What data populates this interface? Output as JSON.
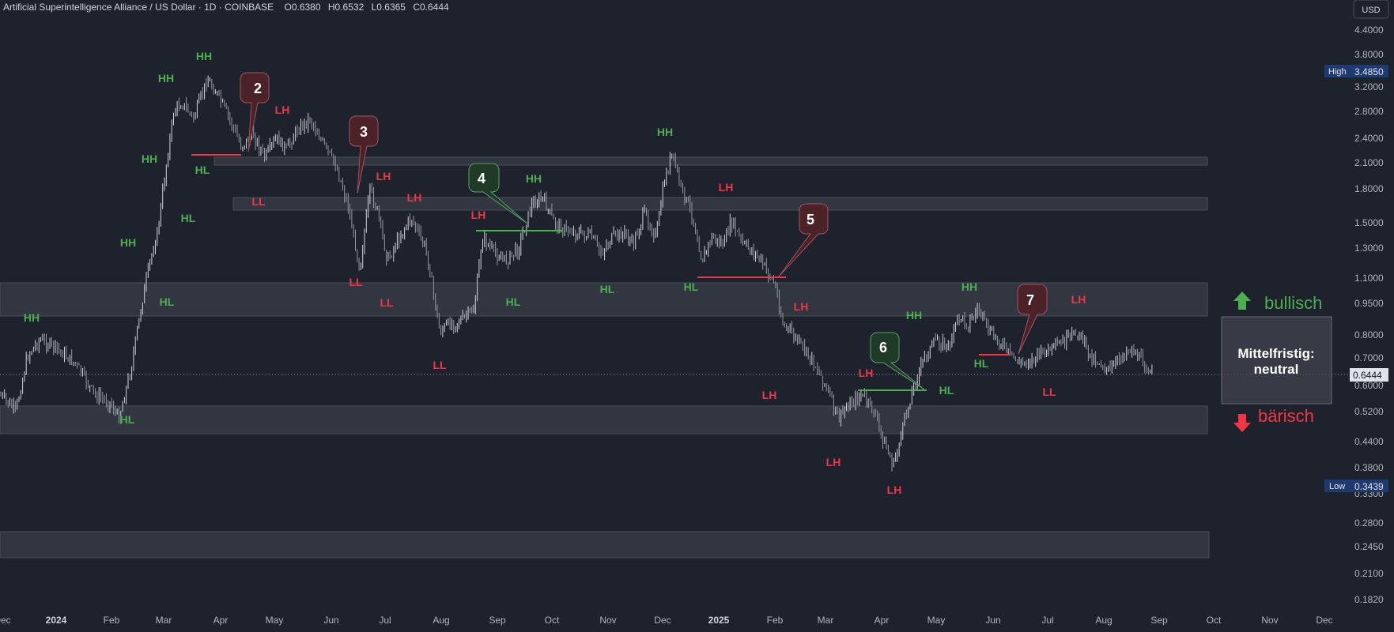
{
  "header": {
    "symbol": "Artificial Superintelligence Alliance / US Dollar · 1D · COINBASE",
    "open": "O0.6380",
    "high": "H0.6532",
    "low": "L0.6365",
    "close": "C0.6444"
  },
  "currency_button": "USD",
  "price_axis": {
    "ticks": [
      "4.4000",
      "3.8000",
      "3.2000",
      "2.8000",
      "2.4000",
      "2.1000",
      "1.8000",
      "1.5000",
      "1.3000",
      "1.1000",
      "0.9500",
      "0.8000",
      "0.7000",
      "0.6000",
      "0.5200",
      "0.4400",
      "0.3800",
      "0.2800",
      "0.2450",
      "0.2100",
      "0.1820"
    ],
    "partial_tick": "0.3300",
    "high_label": "High",
    "high_value": "3.4850",
    "low_label": "Low",
    "low_value": "0.3439",
    "current_value": "0.6444"
  },
  "time_axis": [
    "Dec",
    "2024",
    "Feb",
    "Mar",
    "Apr",
    "May",
    "Jun",
    "Jul",
    "Aug",
    "Sep",
    "Oct",
    "Nov",
    "Dec",
    "2025",
    "Feb",
    "Mar",
    "Apr",
    "May",
    "Jun",
    "Jul",
    "Aug",
    "Sep",
    "Oct",
    "Nov",
    "Dec"
  ],
  "structure_labels": [
    {
      "text": "HH",
      "kind": "bull"
    },
    {
      "text": "HL",
      "kind": "bull"
    },
    {
      "text": "HH",
      "kind": "bull"
    },
    {
      "text": "HL",
      "kind": "bull"
    },
    {
      "text": "HH",
      "kind": "bull"
    },
    {
      "text": "HL",
      "kind": "bull"
    },
    {
      "text": "HH",
      "kind": "bull"
    },
    {
      "text": "HL",
      "kind": "bull"
    },
    {
      "text": "HH",
      "kind": "bull"
    },
    {
      "text": "LH",
      "kind": "bear"
    },
    {
      "text": "LL",
      "kind": "bear"
    },
    {
      "text": "LH",
      "kind": "bear"
    },
    {
      "text": "LL",
      "kind": "bear"
    },
    {
      "text": "LH",
      "kind": "bear"
    },
    {
      "text": "LL",
      "kind": "bear"
    },
    {
      "text": "LL",
      "kind": "bear"
    },
    {
      "text": "LH",
      "kind": "bear"
    },
    {
      "text": "HH",
      "kind": "bull"
    },
    {
      "text": "HL",
      "kind": "bull"
    },
    {
      "text": "HL",
      "kind": "bull"
    },
    {
      "text": "HH",
      "kind": "bull"
    },
    {
      "text": "LH",
      "kind": "bear"
    },
    {
      "text": "HL",
      "kind": "bull"
    },
    {
      "text": "LH",
      "kind": "bear"
    },
    {
      "text": "LH",
      "kind": "bear"
    },
    {
      "text": "LH",
      "kind": "bear"
    },
    {
      "text": "LH",
      "kind": "bear"
    },
    {
      "text": "LH",
      "kind": "bear"
    },
    {
      "text": "HH",
      "kind": "bull"
    },
    {
      "text": "HL",
      "kind": "bull"
    },
    {
      "text": "HH",
      "kind": "bull"
    },
    {
      "text": "HL",
      "kind": "bull"
    },
    {
      "text": "LH",
      "kind": "bear"
    },
    {
      "text": "LL",
      "kind": "bear"
    }
  ],
  "callouts": [
    {
      "text": "2",
      "kind": "bear"
    },
    {
      "text": "3",
      "kind": "bear"
    },
    {
      "text": "4",
      "kind": "bull"
    },
    {
      "text": "5",
      "kind": "bear"
    },
    {
      "text": "6",
      "kind": "bull"
    },
    {
      "text": "7",
      "kind": "bear"
    }
  ],
  "sentiment": {
    "bullish_label": "bullisch",
    "bearish_label": "bärisch",
    "box_line1": "Mittelfristig:",
    "box_line2": "neutral"
  },
  "colors": {
    "background": "#1e222d",
    "bull": "#4caf50",
    "bear": "#f23645",
    "zone": "#3a3e48",
    "callout_bear": "#4a2228",
    "callout_bull": "#1f3a27"
  }
}
